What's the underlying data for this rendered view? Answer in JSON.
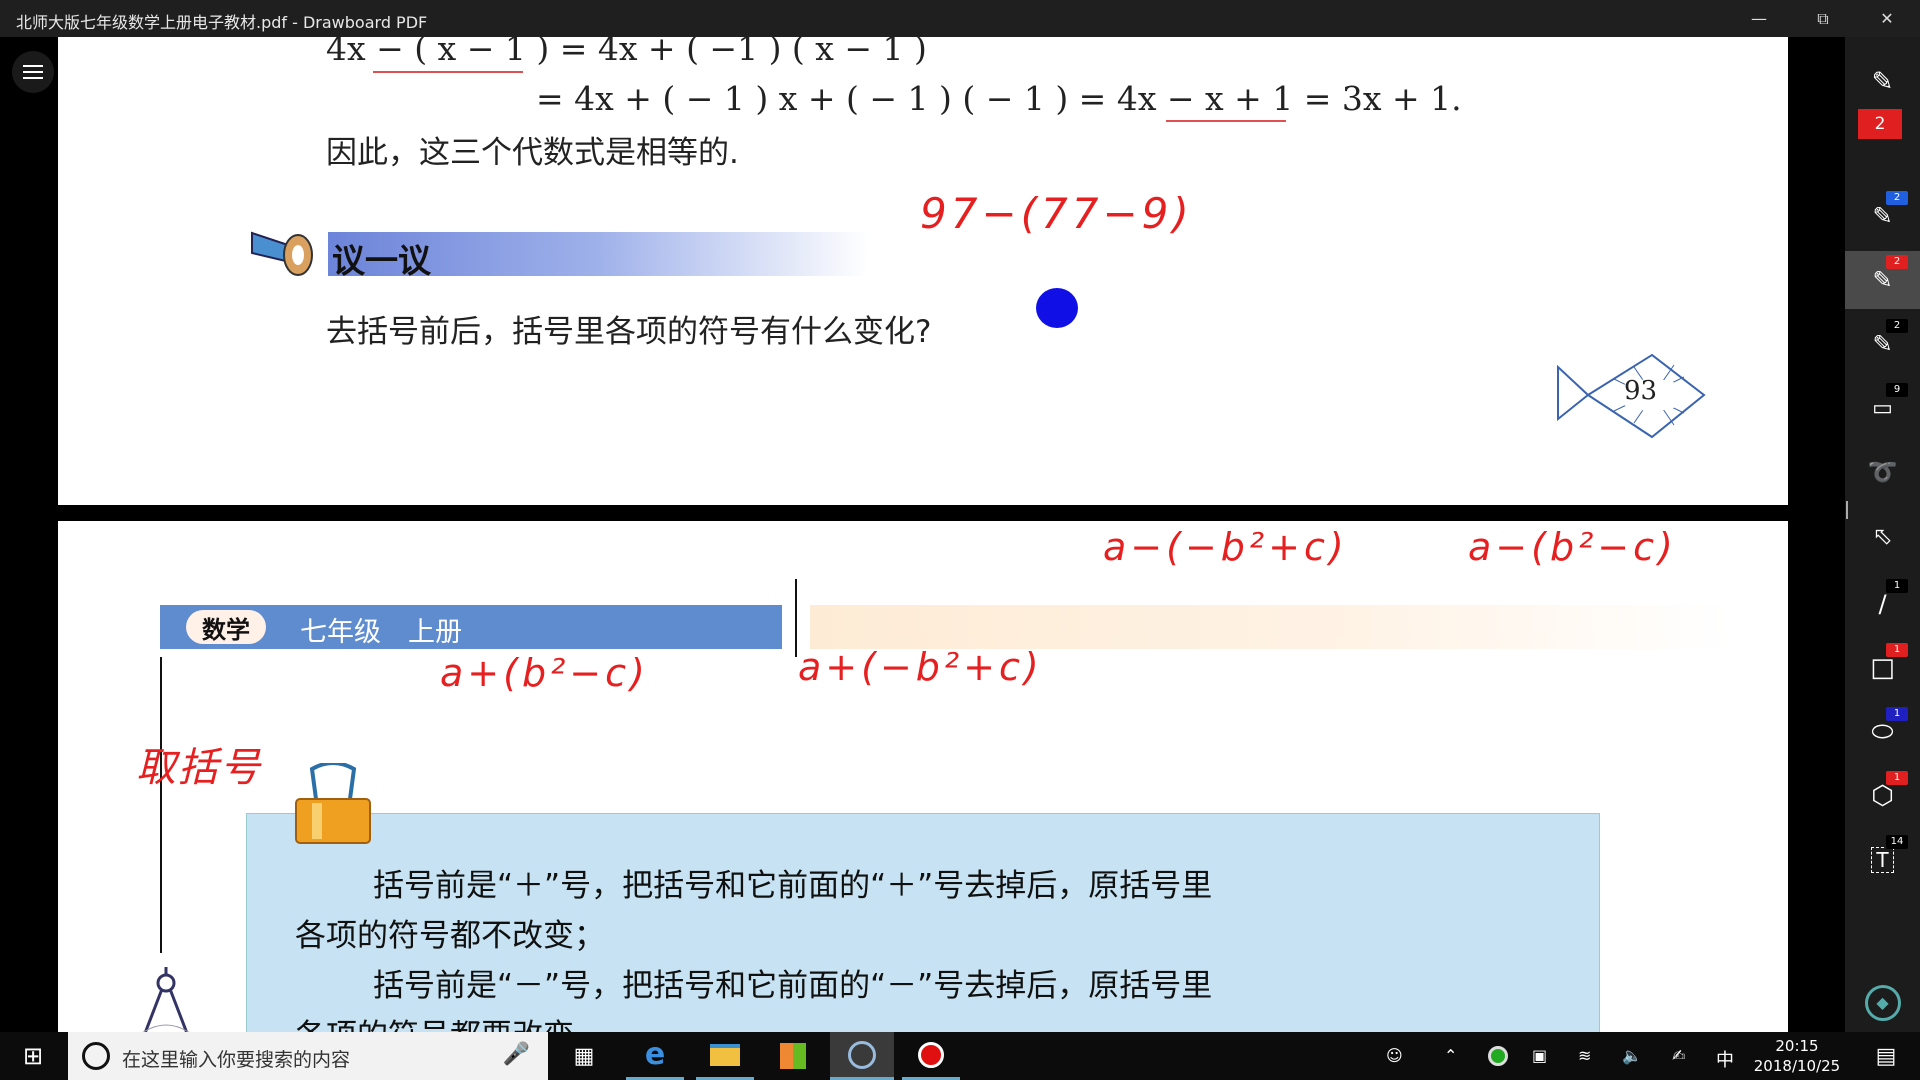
{
  "window": {
    "title": "北师大版七年级数学上册电子教材.pdf - Drawboard PDF",
    "minimize_icon": "minimize-icon",
    "restore_icon": "restore-icon",
    "close_icon": "close-icon"
  },
  "page1": {
    "eq_line1": "4x − ( x − 1 ) = 4x + ( −1 ) ( x − 1 )",
    "eq_line2": "= 4x + ( − 1 ) x + ( − 1 ) ( − 1 ) = 4x − x + 1 = 3x + 1.",
    "conclusion": "因此，这三个代数式是相等的.",
    "section_label": "议一议",
    "question": "去括号前后，括号里各项的符号有什么变化?",
    "page_number": "93",
    "handwriting": "97−(77−9)"
  },
  "page2": {
    "subject_badge": "数学",
    "grade_label": "七年级　上册",
    "hand_top_1": "a−(−b²+c)",
    "hand_top_2": "a−(b²−c)",
    "hand_mid_1": "a+(b²−c)",
    "hand_mid_2": "a+(−b²+c)",
    "hand_side": "取括号",
    "rule_1a": "括号前是“＋”号，把括号和它前面的“＋”号去掉后，原括号里",
    "rule_1b": "各项的符号都不改变；",
    "rule_2a": "括号前是“－”号，把括号和它前面的“－”号去掉后，原括号里",
    "rule_2b": "各项的符号都要改变."
  },
  "sidebar": {
    "ink_count": "2",
    "tools": [
      {
        "name": "pen-tool-blue",
        "count": "2",
        "badge_color": "#2060e0"
      },
      {
        "name": "pen-tool-red",
        "count": "2",
        "badge_color": "#e02020"
      },
      {
        "name": "pen-tool-black",
        "count": "2",
        "badge_color": "#000000"
      },
      {
        "name": "highlighter-tool",
        "count": "9",
        "badge_color": "#000000"
      },
      {
        "name": "lasso-tool",
        "count": "",
        "badge_color": ""
      },
      {
        "name": "select-tool",
        "count": "",
        "badge_color": ""
      },
      {
        "name": "line-tool",
        "count": "1",
        "badge_color": "#000000"
      },
      {
        "name": "rectangle-tool",
        "count": "1",
        "badge_color": "#e02020"
      },
      {
        "name": "ellipse-tool",
        "count": "1",
        "badge_color": "#2020c0"
      },
      {
        "name": "polygon-tool",
        "count": "1",
        "badge_color": "#e02020"
      },
      {
        "name": "text-tool",
        "count": "14",
        "badge_color": "#000000"
      }
    ]
  },
  "taskbar": {
    "search_placeholder": "在这里输入你要搜索的内容",
    "ime": "中",
    "time": "20:15",
    "date": "2018/10/25"
  }
}
